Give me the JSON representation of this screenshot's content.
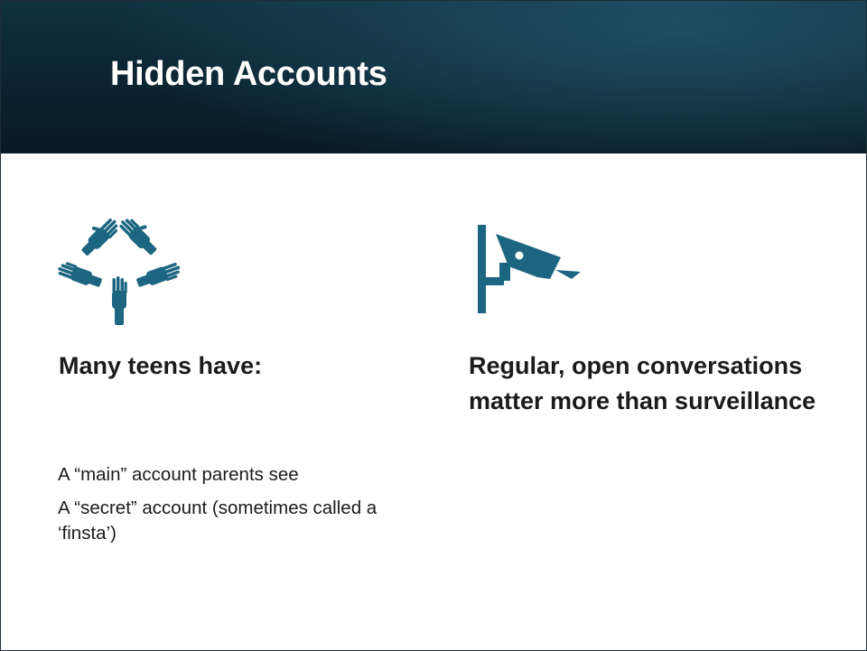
{
  "slide": {
    "title": "Hidden Accounts",
    "left_column": {
      "icon": "hands-circle-icon",
      "heading": "Many teens have:",
      "items": [
        "A “main” account parents see",
        "A “secret” account (sometimes called a ‘finsta’)"
      ]
    },
    "right_column": {
      "icon": "security-camera-icon",
      "heading": "Regular, open conversations matter more than surveillance"
    }
  },
  "colors": {
    "header_dark": "#0b2430",
    "header_light": "#1f4e63",
    "icon": "#1d6682",
    "title_text": "#ffffff",
    "body_text": "#1b1b1b"
  }
}
